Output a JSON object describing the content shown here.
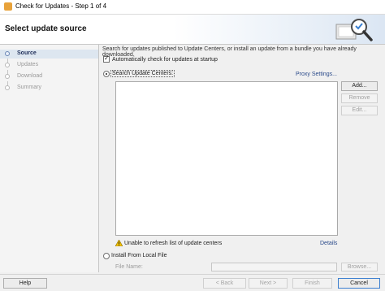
{
  "window": {
    "title": "Check for Updates - Step 1 of 4"
  },
  "header": {
    "title": "Select update source"
  },
  "steps": [
    {
      "label": "Source",
      "active": true
    },
    {
      "label": "Updates",
      "active": false
    },
    {
      "label": "Download",
      "active": false
    },
    {
      "label": "Summary",
      "active": false
    }
  ],
  "main": {
    "description": "Search for updates published to Update Centers, or install an update from a bundle you have already downloaded.",
    "auto_check_label": "Automatically check for updates at startup",
    "auto_check_checked": true,
    "search_label": "Search Update Centers:",
    "search_selected": true,
    "proxy_link": "Proxy Settings...",
    "update_centers": [],
    "buttons": {
      "add": "Add...",
      "remove": "Remove",
      "edit": "Edit..."
    },
    "warning_text": "Unable to refresh list of update centers",
    "details_link": "Details",
    "install_local_label": "Install From Local File",
    "file_name_label": "File Name:",
    "file_name_value": "",
    "browse_button": "Browse..."
  },
  "footer": {
    "help": "Help",
    "back": "< Back",
    "next": "Next >",
    "finish": "Finish",
    "cancel": "Cancel"
  },
  "colors": {
    "accent": "#3c7fd0",
    "link": "#2a4a8a",
    "warning": "#f2c200"
  }
}
